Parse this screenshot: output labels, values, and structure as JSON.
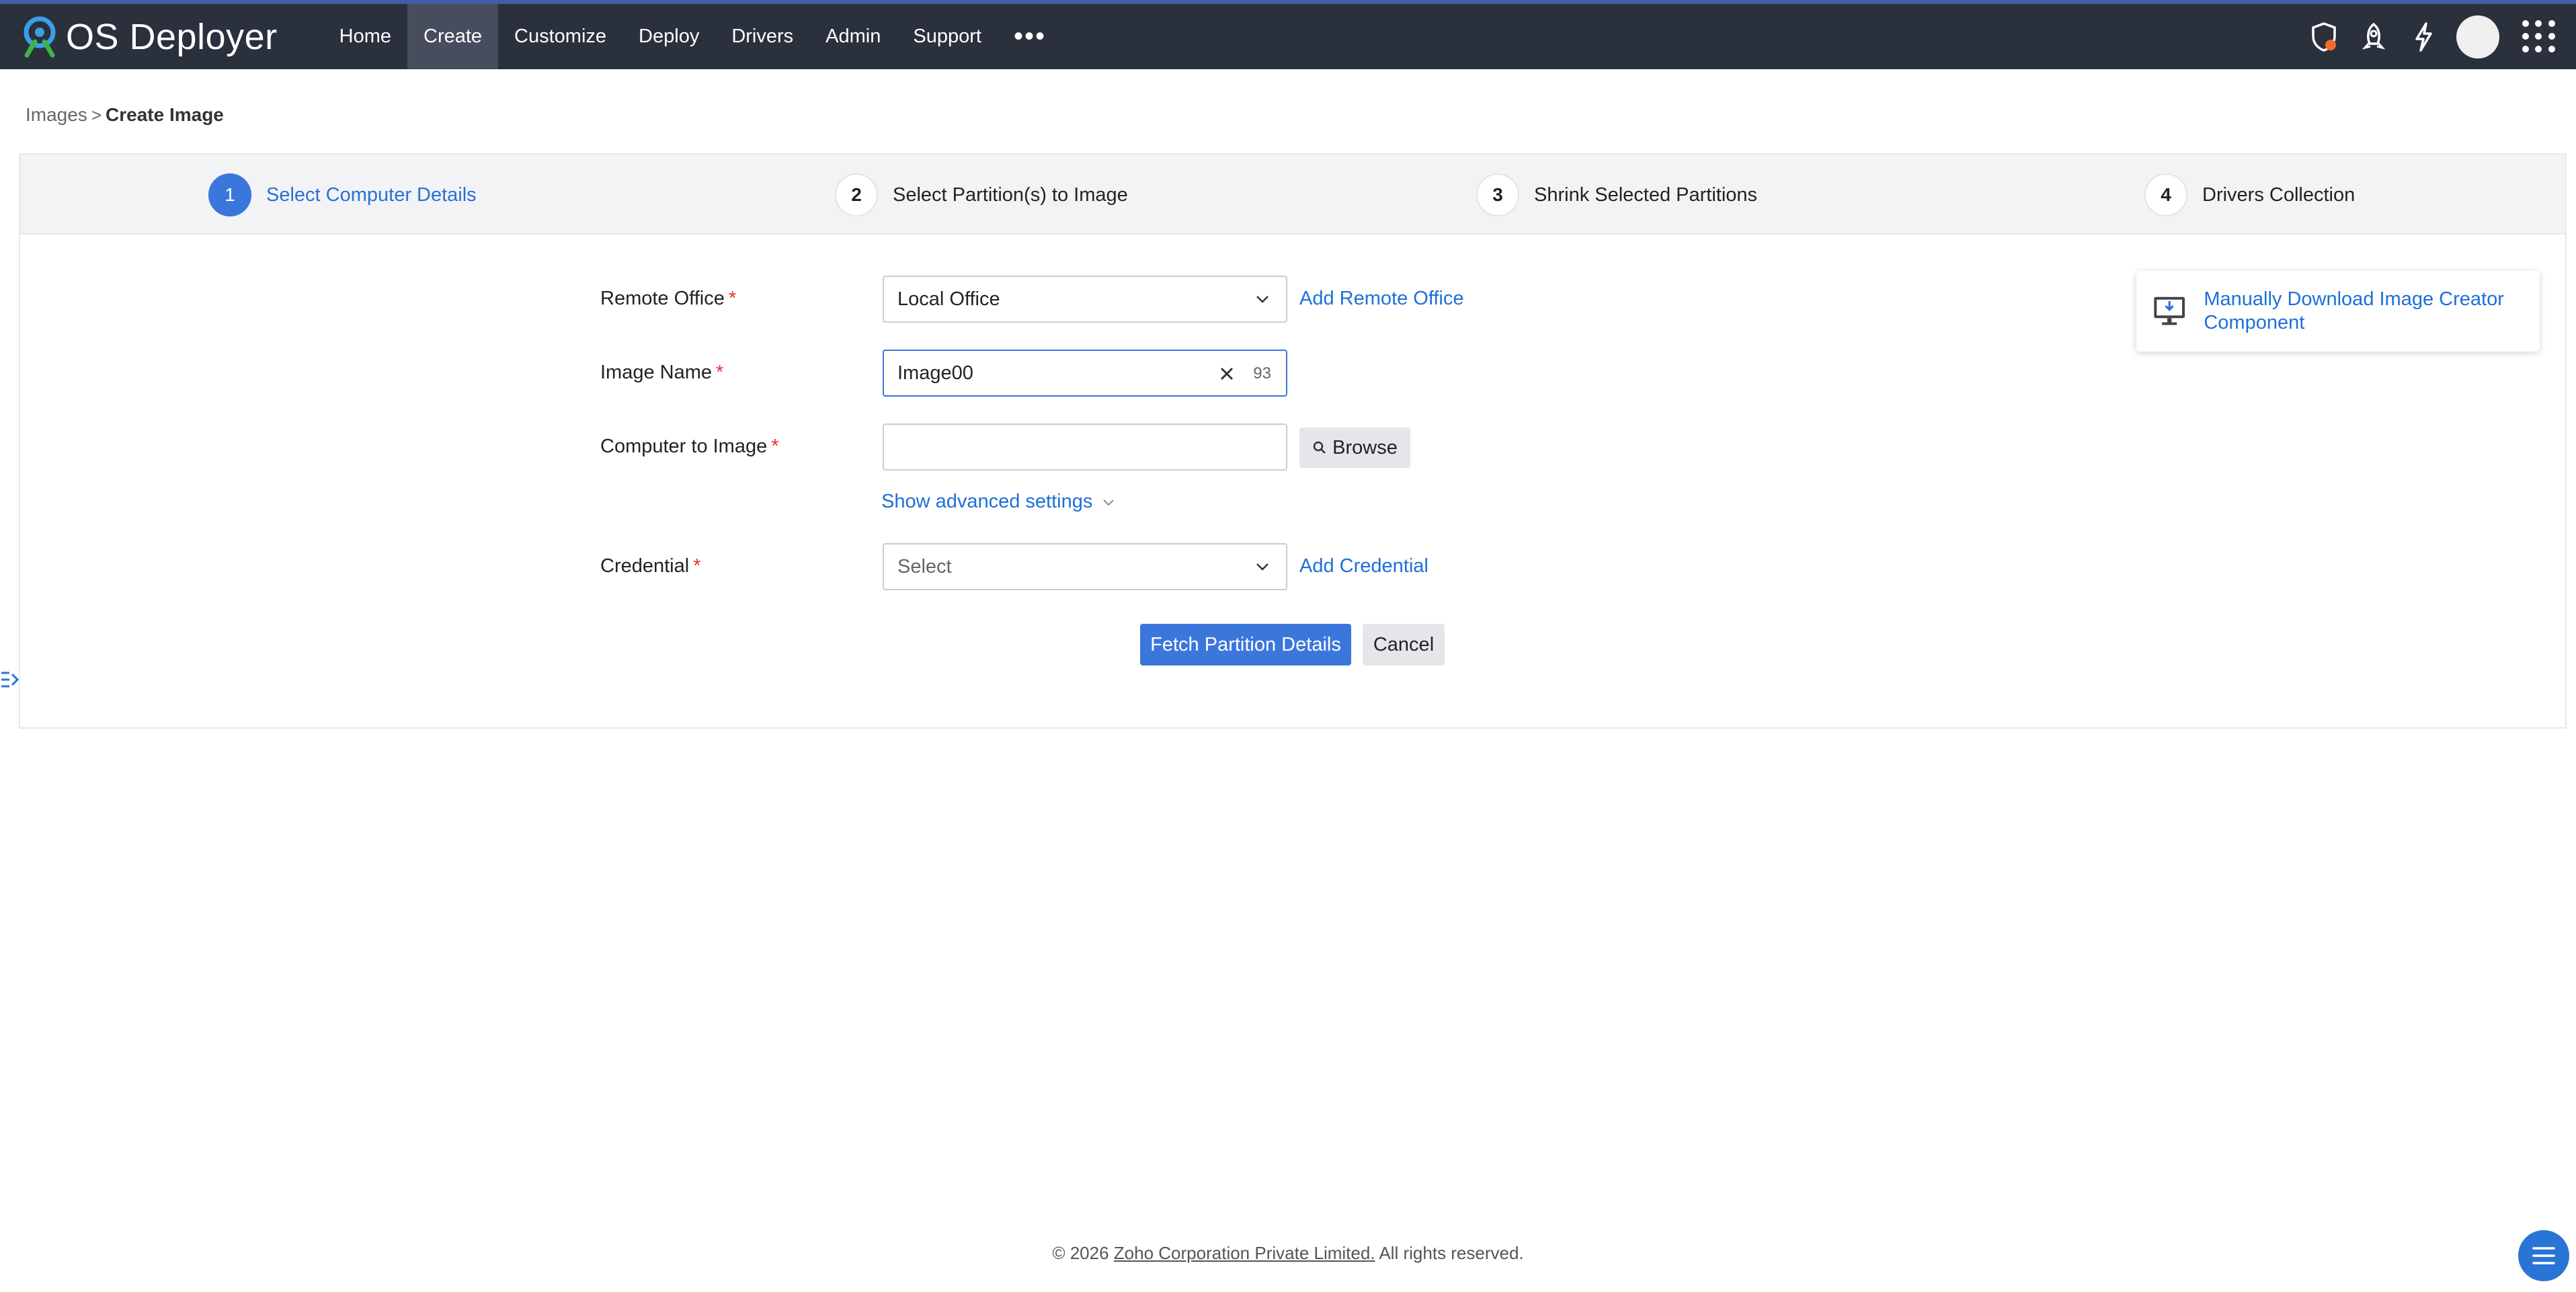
{
  "header": {
    "brand": "OS Deployer",
    "nav": [
      "Home",
      "Create",
      "Customize",
      "Deploy",
      "Drivers",
      "Admin",
      "Support"
    ],
    "active_nav": "Create",
    "more": "•••"
  },
  "breadcrumb": {
    "parent": "Images",
    "separator": ">",
    "current": "Create Image"
  },
  "steps": [
    {
      "num": "1",
      "label": "Select Computer Details",
      "active": true
    },
    {
      "num": "2",
      "label": "Select Partition(s) to Image",
      "active": false
    },
    {
      "num": "3",
      "label": "Shrink Selected Partitions",
      "active": false
    },
    {
      "num": "4",
      "label": "Drivers Collection",
      "active": false
    }
  ],
  "form": {
    "remote_office": {
      "label": "Remote Office",
      "required": "*",
      "value": "Local Office",
      "link": "Add Remote Office"
    },
    "image_name": {
      "label": "Image Name",
      "required": "*",
      "value": "Image00",
      "counter": "93"
    },
    "computer": {
      "label": "Computer to Image",
      "required": "*",
      "value": "",
      "button": "Browse"
    },
    "advanced": "Show advanced settings",
    "credential": {
      "label": "Credential",
      "required": "*",
      "placeholder": "Select",
      "link": "Add Credential"
    },
    "submit": "Fetch Partition Details",
    "cancel": "Cancel"
  },
  "download_card": {
    "text": "Manually Download Image Creator Component",
    "icon": "monitor-download-icon"
  },
  "footer": {
    "prefix": "© 2026",
    "company": "Zoho Corporation Private Limited.",
    "suffix": "All rights reserved."
  },
  "colors": {
    "topbar": "#2b303d",
    "accent": "#3b77db",
    "link": "#1d6fd9",
    "required": "#e0352f"
  }
}
